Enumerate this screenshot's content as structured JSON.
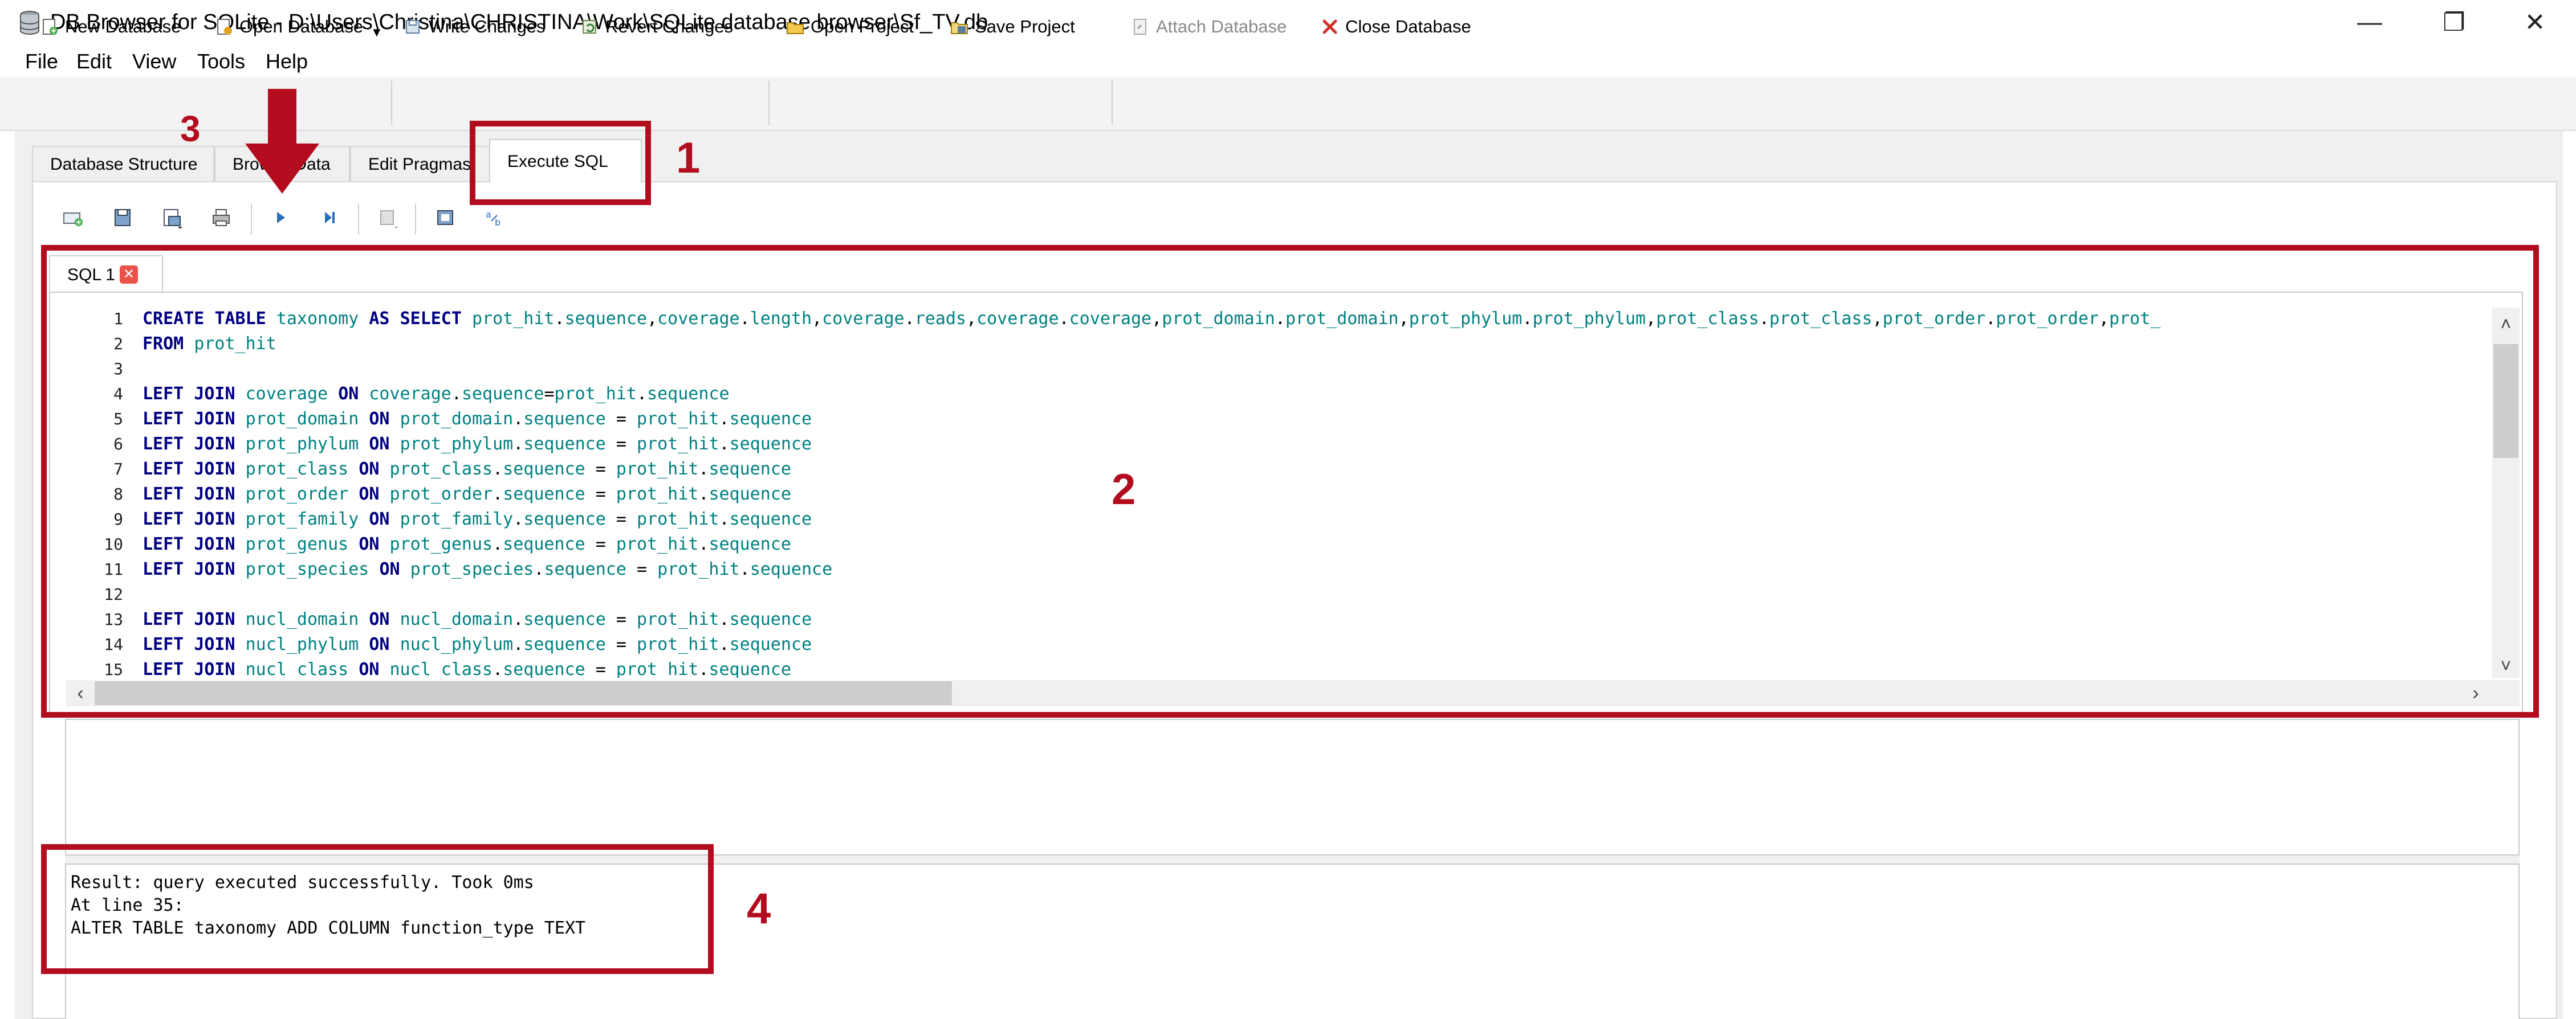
{
  "window": {
    "title": "DB Browser for SQLite - D:\\Users\\Christina\\CHRISTINA\\Work\\SQLite database browser\\Sf_TV.db",
    "minimize_glyph": "—",
    "maximize_glyph": "❐",
    "close_glyph": "✕"
  },
  "menu": [
    "File",
    "Edit",
    "View",
    "Tools",
    "Help"
  ],
  "toolbar": {
    "new_database": "New Database",
    "open_database": "Open Database",
    "open_dropdown_glyph": "▼",
    "write_changes": "Write Changes",
    "revert_changes": "Revert Changes",
    "open_project": "Open Project",
    "save_project": "Save Project",
    "attach_database": "Attach Database",
    "close_database": "Close Database"
  },
  "tabs": {
    "database_structure": "Database Structure",
    "browse_data": "Browse Data",
    "edit_pragmas": "Edit Pragmas",
    "execute_sql": "Execute SQL",
    "active": "Execute SQL"
  },
  "sql_toolbar_icons": [
    "open-tab-icon",
    "open-sql-file-icon",
    "save-sql-file-icon",
    "print-icon",
    "execute-all-icon",
    "execute-current-line-icon",
    "save-results-icon",
    "find-icon",
    "find-replace-icon"
  ],
  "editor": {
    "tab_label": "SQL 1",
    "tab_close_glyph": "✕",
    "line_numbers": [
      "1",
      "2",
      "3",
      "4",
      "5",
      "6",
      "7",
      "8",
      "9",
      "10",
      "11",
      "12",
      "13",
      "14",
      "15"
    ],
    "lines": [
      "CREATE TABLE taxonomy AS SELECT prot_hit.sequence,coverage.length,coverage.reads,coverage.coverage,prot_domain.prot_domain,prot_phylum.prot_phylum,prot_class.prot_class,prot_order.prot_order,prot_",
      "FROM prot_hit",
      "",
      "LEFT JOIN coverage ON coverage.sequence=prot_hit.sequence",
      "LEFT JOIN prot_domain ON prot_domain.sequence = prot_hit.sequence",
      "LEFT JOIN prot_phylum ON prot_phylum.sequence = prot_hit.sequence",
      "LEFT JOIN prot_class ON prot_class.sequence = prot_hit.sequence",
      "LEFT JOIN prot_order ON prot_order.sequence = prot_hit.sequence",
      "LEFT JOIN prot_family ON prot_family.sequence = prot_hit.sequence",
      "LEFT JOIN prot_genus ON prot_genus.sequence = prot_hit.sequence",
      "LEFT JOIN prot_species ON prot_species.sequence = prot_hit.sequence",
      "",
      "LEFT JOIN nucl_domain ON nucl_domain.sequence = prot_hit.sequence",
      "LEFT JOIN nucl_phylum ON nucl_phylum.sequence = prot_hit.sequence",
      "LEFT JOIN nucl_class ON nucl_class.sequence = prot_hit.sequence"
    ],
    "scroll_up_glyph": "˄",
    "scroll_down_glyph": "˅",
    "scroll_left_glyph": "‹",
    "scroll_right_glyph": "›"
  },
  "messages": [
    "Result: query executed successfully. Took 0ms",
    "At line 35:",
    "ALTER TABLE taxonomy ADD COLUMN function_type TEXT"
  ],
  "annotations": {
    "one": "1",
    "two": "2",
    "three": "3",
    "four": "4",
    "color": "#b20c1e"
  },
  "colors": {
    "keyword": "#000080",
    "identifier": "#008080",
    "close_database_icon": "#d0312d",
    "execute_icon": "#2a6ebb"
  }
}
